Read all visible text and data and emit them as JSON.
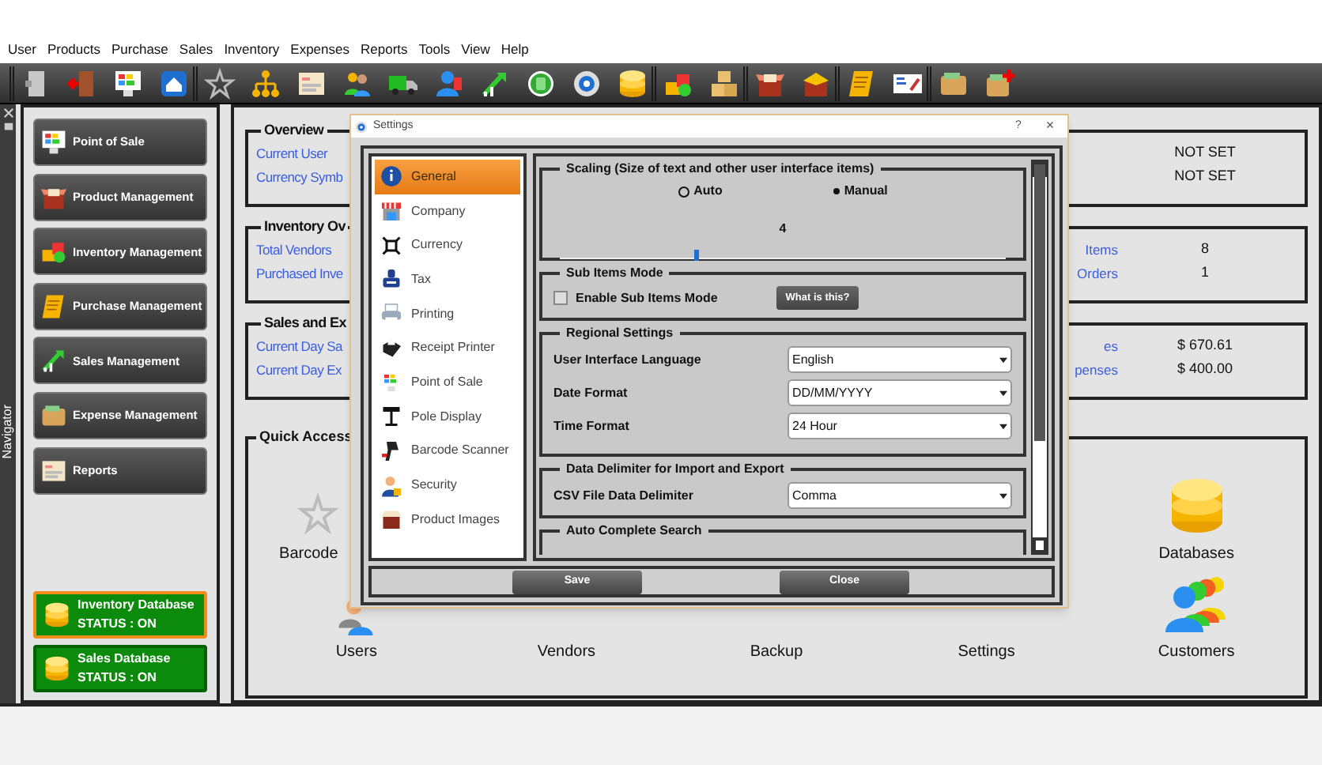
{
  "menu": [
    "User",
    "Products",
    "Purchase",
    "Sales",
    "Inventory",
    "Expenses",
    "Reports",
    "Tools",
    "View",
    "Help"
  ],
  "navigator": {
    "label": "Navigator"
  },
  "nav_buttons": [
    "Point of Sale",
    "Product Management",
    "Inventory Management",
    "Purchase Management",
    "Sales Management",
    "Expense Management",
    "Reports"
  ],
  "databases": [
    {
      "name": "Inventory Database",
      "status": "STATUS : ON",
      "selected": true
    },
    {
      "name": "Sales Database",
      "status": "STATUS : ON",
      "selected": false
    }
  ],
  "groups": [
    {
      "title": "Overview",
      "rows": [
        {
          "label": "Current User",
          "value": "NOT SET"
        },
        {
          "label": "Currency Symb",
          "value": "NOT SET"
        }
      ]
    },
    {
      "title": "Inventory Ov",
      "rows": [
        {
          "label": "Total Vendors",
          "label_2": "Items",
          "value": "8"
        },
        {
          "label": "Purchased Inve",
          "label_2": "Orders",
          "value": "1"
        }
      ]
    },
    {
      "title": "Sales and Ex",
      "rows": [
        {
          "label": "Current Day Sa",
          "label_2": "es",
          "value": "$ 670.61"
        },
        {
          "label": "Current Day Ex",
          "label_2": "penses",
          "value": "$ 400.00"
        }
      ]
    }
  ],
  "quick_access": {
    "title": "Quick Access",
    "items": [
      {
        "label": "Barcode",
        "kind": "star"
      },
      {
        "label": "Databases",
        "kind": "database"
      },
      {
        "label": "Users",
        "kind": "person"
      },
      {
        "label": "Vendors",
        "kind": "covered"
      },
      {
        "label": "Backup",
        "kind": "covered"
      },
      {
        "label": "Settings",
        "kind": "covered"
      },
      {
        "label": "Customers",
        "kind": "people"
      }
    ]
  },
  "dialog": {
    "title": "Settings",
    "help": "?",
    "close": "×",
    "categories": [
      {
        "label": "General",
        "selected": true
      },
      {
        "label": "Company",
        "selected": false
      },
      {
        "label": "Currency",
        "selected": false
      },
      {
        "label": "Tax",
        "selected": false
      },
      {
        "label": "Printing",
        "selected": false
      },
      {
        "label": "Receipt Printer",
        "selected": false
      },
      {
        "label": "Point of Sale",
        "selected": false
      },
      {
        "label": "Pole Display",
        "selected": false
      },
      {
        "label": "Barcode Scanner",
        "selected": false
      },
      {
        "label": "Security",
        "selected": false
      },
      {
        "label": "Product Images",
        "selected": false
      }
    ],
    "scaling": {
      "title": "Scaling (Size of text and other user interface items)",
      "options": [
        {
          "label": "Auto",
          "selected": false
        },
        {
          "label": "Manual",
          "selected": true
        }
      ],
      "value": "4",
      "level": 0.3
    },
    "sub_items": {
      "title": "Sub Items Mode",
      "checkbox_label": "Enable Sub Items Mode",
      "checked": false,
      "button": "What is this?"
    },
    "regional": {
      "title": "Regional Settings",
      "fields": [
        {
          "label": "User Interface Language",
          "value": "English"
        },
        {
          "label": "Date Format",
          "value": "DD/MM/YYYY"
        },
        {
          "label": "Time Format",
          "value": "24 Hour"
        }
      ]
    },
    "delimiter": {
      "title": "Data Delimiter for Import and Export",
      "fields": [
        {
          "label": "CSV File Data Delimiter",
          "value": "Comma"
        }
      ]
    },
    "auto_complete": {
      "title": "Auto Complete Search"
    },
    "buttons": [
      "Save",
      "Close"
    ]
  }
}
